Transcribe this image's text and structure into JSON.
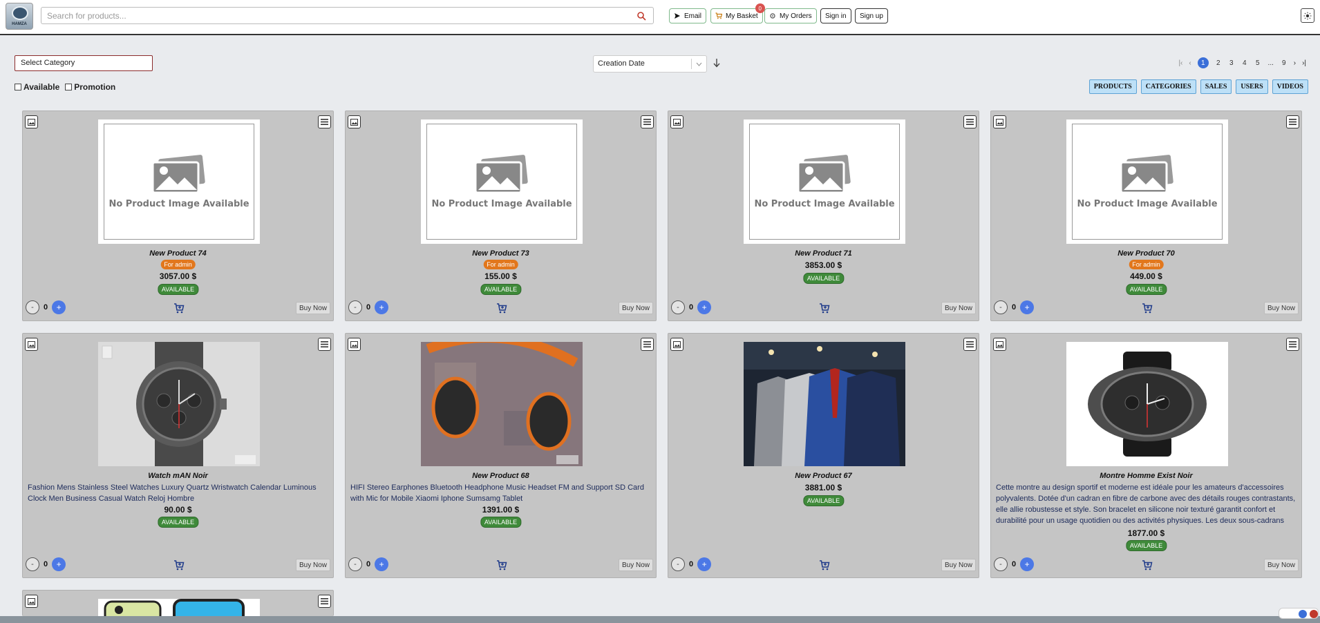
{
  "header": {
    "logo_text": "HAMZA",
    "search_placeholder": "Search for products...",
    "email_label": "Email",
    "basket_label": "My Basket",
    "basket_count": "0",
    "orders_label": "My Orders",
    "signin_label": "Sign in",
    "signup_label": "Sign up"
  },
  "filters": {
    "category_placeholder": "Select Category",
    "available_label": "Available",
    "promotion_label": "Promotion",
    "sort_value": "Creation Date"
  },
  "pagination": {
    "pages": [
      "1",
      "2",
      "3",
      "4",
      "5",
      "...",
      "9"
    ],
    "active": "1"
  },
  "admin_tabs": [
    "PRODUCTS",
    "CATEGORIES",
    "SALES",
    "USERS",
    "VIDEOS"
  ],
  "placeholder_text": "No Product Image Available",
  "products": [
    {
      "title": "New Product 74",
      "admin": "For admin",
      "price": "3057.00 $",
      "status": "AVAILABLE",
      "qty": "0",
      "buy": "Buy Now"
    },
    {
      "title": "New Product 73",
      "admin": "For admin",
      "price": "155.00 $",
      "status": "AVAILABLE",
      "qty": "0",
      "buy": "Buy Now"
    },
    {
      "title": "New Product 71",
      "price": "3853.00 $",
      "status": "AVAILABLE",
      "qty": "0",
      "buy": "Buy Now"
    },
    {
      "title": "New Product 70",
      "admin": "For admin",
      "price": "449.00 $",
      "status": "AVAILABLE",
      "qty": "0",
      "buy": "Buy Now"
    },
    {
      "title": "Watch mAN Noir",
      "desc": "Fashion Mens Stainless Steel Watches Luxury Quartz Wristwatch Calendar Luminous Clock Men Business Casual Watch Reloj Hombre",
      "price": "90.00 $",
      "status": "AVAILABLE",
      "qty": "0",
      "buy": "Buy Now"
    },
    {
      "title": "New Product 68",
      "desc": "HIFI Stereo Earphones Bluetooth Headphone Music Headset FM and Support SD Card with Mic for Mobile Xiaomi Iphone Sumsamg Tablet",
      "price": "1391.00 $",
      "status": "AVAILABLE",
      "qty": "0",
      "buy": "Buy Now"
    },
    {
      "title": "New Product 67",
      "price": "3881.00 $",
      "status": "AVAILABLE",
      "qty": "0",
      "buy": "Buy Now"
    },
    {
      "title": "Montre Homme Exist Noir",
      "desc": "Cette montre au design sportif et moderne est idéale pour les amateurs d'accessoires polyvalents. Dotée d'un cadran en fibre de carbone avec des détails rouges contrastants, elle allie robustesse et style. Son bracelet en silicone noir texturé garantit confort et durabilité pour un usage quotidien ou des activités physiques. Les deux sous-cadrans",
      "price": "1877.00 $",
      "status": "AVAILABLE",
      "qty": "0",
      "buy": "Buy Now"
    }
  ]
}
